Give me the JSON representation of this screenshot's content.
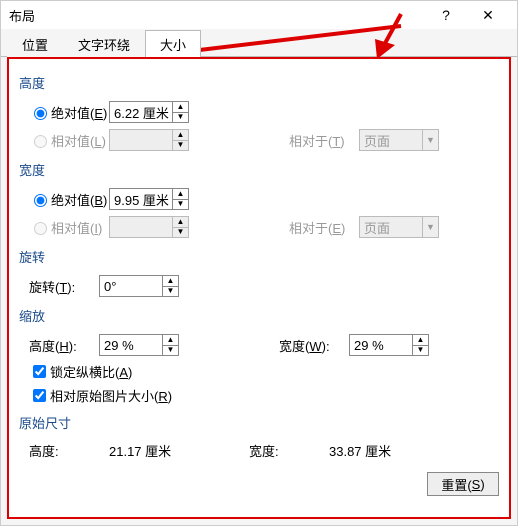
{
  "window": {
    "title": "布局",
    "help": "?",
    "close": "✕"
  },
  "tabs": [
    {
      "label": "位置",
      "active": false
    },
    {
      "label": "文字环绕",
      "active": false
    },
    {
      "label": "大小",
      "active": true
    }
  ],
  "height": {
    "section": "高度",
    "abs_label_pre": "绝对值(",
    "abs_key": "E",
    "abs_label_post": ")",
    "abs_value": "6.22 厘米",
    "rel_label_pre": "相对值(",
    "rel_key": "L",
    "rel_label_post": ")",
    "rel_to_pre": "相对于(",
    "rel_to_key": "T",
    "rel_to_post": ")",
    "rel_to_value": "页面"
  },
  "width": {
    "section": "宽度",
    "abs_label_pre": "绝对值(",
    "abs_key": "B",
    "abs_label_post": ")",
    "abs_value": "9.95 厘米",
    "rel_label_pre": "相对值(",
    "rel_key": "I",
    "rel_label_post": ")",
    "rel_to_pre": "相对于(",
    "rel_to_key": "E",
    "rel_to_post": ")",
    "rel_to_value": "页面"
  },
  "rotation": {
    "section": "旋转",
    "label_pre": "旋转(",
    "label_key": "T",
    "label_post": "):",
    "value": "0°"
  },
  "scale": {
    "section": "缩放",
    "h_label_pre": "高度(",
    "h_key": "H",
    "h_label_post": "):",
    "h_value": "29 %",
    "w_label_pre": "宽度(",
    "w_key": "W",
    "w_label_post": "):",
    "w_value": "29 %",
    "lock_pre": "锁定纵横比(",
    "lock_key": "A",
    "lock_post": ")",
    "rel_pre": "相对原始图片大小(",
    "rel_key": "R",
    "rel_post": ")"
  },
  "original": {
    "section": "原始尺寸",
    "h_label": "高度:",
    "h_value": "21.17 厘米",
    "w_label": "宽度:",
    "w_value": "33.87 厘米"
  },
  "reset_pre": "重置(",
  "reset_key": "S",
  "reset_post": ")"
}
